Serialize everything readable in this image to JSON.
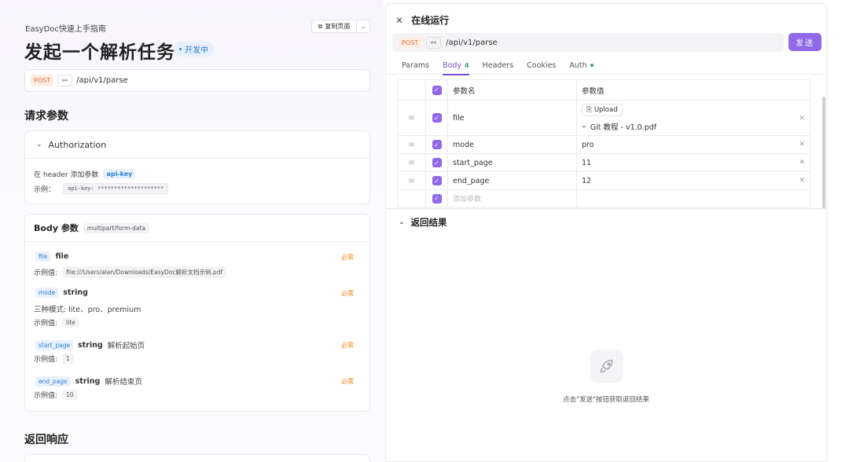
{
  "doc": {
    "breadcrumb": "EasyDoc快速上手指南",
    "copy_label": "复制页面",
    "title": "发起一个解析任务",
    "status_badge": "开发中",
    "method": "POST",
    "path": "/api/v1/parse",
    "request_params_heading": "请求参数",
    "auth": {
      "title": "Authorization",
      "desc_prefix": "在 header 添加参数",
      "key_name": "api-key",
      "example_label": "示例：",
      "example_value": "api-key: ********************"
    },
    "body": {
      "title": "Body 参数",
      "content_type": "multipart/form-data",
      "required_label": "必需",
      "example_label": "示例值:",
      "params": [
        {
          "name": "file",
          "type": "file",
          "desc": "",
          "extra": "",
          "example": "file:///Users/alan/Downloads/EasyDoc解析文档示例.pdf"
        },
        {
          "name": "mode",
          "type": "string",
          "desc": "",
          "extra": "三种模式: lite、pro、premium",
          "example": "lite"
        },
        {
          "name": "start_page",
          "type": "string",
          "desc": "解析起始页",
          "extra": "",
          "example": "1"
        },
        {
          "name": "end_page",
          "type": "string",
          "desc": "解析结束页",
          "extra": "",
          "example": "10"
        }
      ]
    },
    "response_heading": "返回响应"
  },
  "run": {
    "title": "在线运行",
    "method": "POST",
    "path": "/api/v1/parse",
    "send_label": "发送",
    "tabs": [
      {
        "label": "Params"
      },
      {
        "label": "Body",
        "count": "4"
      },
      {
        "label": "Headers"
      },
      {
        "label": "Cookies"
      },
      {
        "label": "Auth"
      }
    ],
    "table": {
      "col_name": "参数名",
      "col_value": "参数值",
      "upload_label": "Upload",
      "file_name": "Git 教程 - v1.0.pdf",
      "rows": [
        {
          "name": "file",
          "value": ""
        },
        {
          "name": "mode",
          "value": "pro"
        },
        {
          "name": "start_page",
          "value": "11"
        },
        {
          "name": "end_page",
          "value": "12"
        }
      ],
      "add_placeholder": "添加参数"
    },
    "result_heading": "返回结果",
    "empty_hint": "点击\"发送\"按钮获取返回结果"
  },
  "colors": {
    "accent": "#9068e8",
    "post": "#e8723a",
    "required": "#f08a1c",
    "tag_blue": "#2f7fd1"
  }
}
